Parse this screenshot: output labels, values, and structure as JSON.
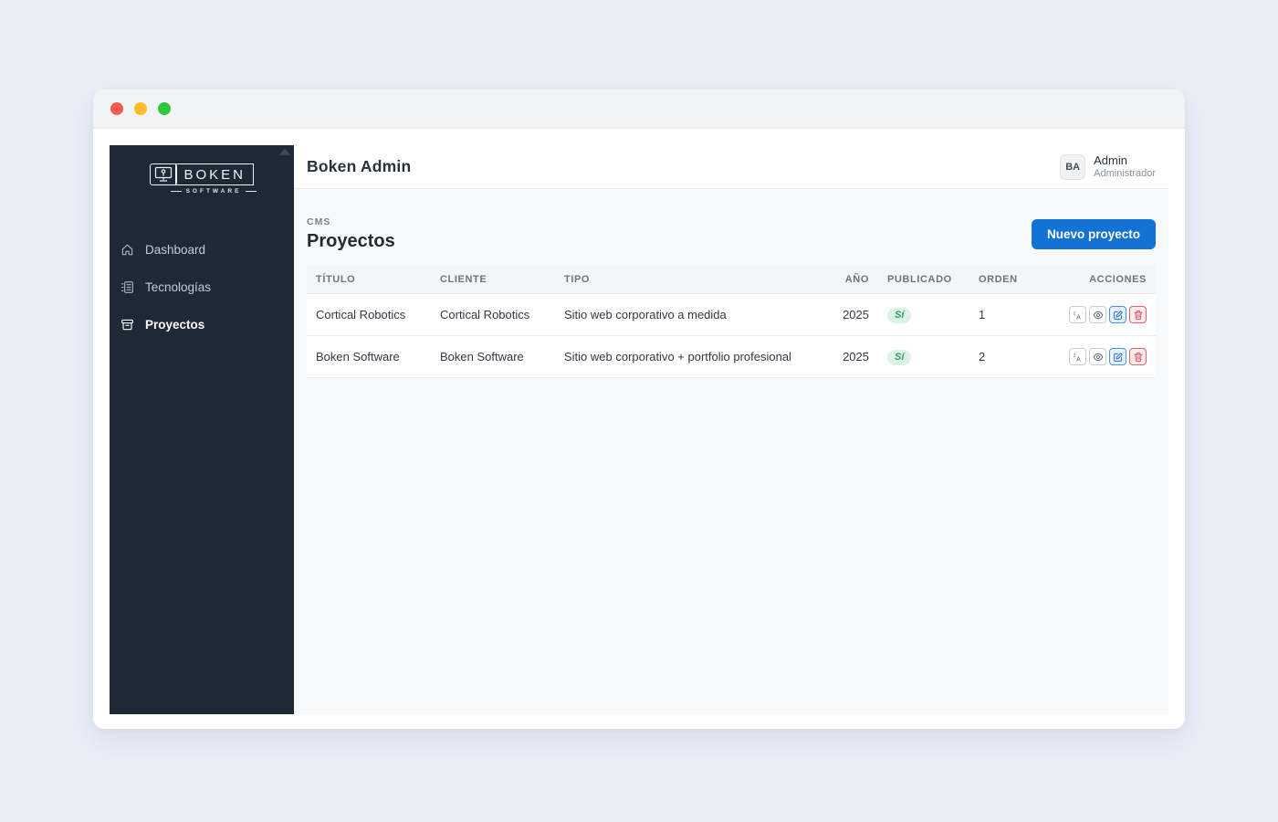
{
  "window": {
    "traffic_lights": {
      "close": "#fb5954",
      "minimize": "#fcba2d",
      "zoom": "#2ec83f"
    }
  },
  "sidebar": {
    "logo": {
      "brand": "BOKEN",
      "sub": "SOFTWARE"
    },
    "items": [
      {
        "label": "Dashboard",
        "icon": "home-icon",
        "active": false
      },
      {
        "label": "Tecnologías",
        "icon": "tech-icon",
        "active": false
      },
      {
        "label": "Proyectos",
        "icon": "projects-icon",
        "active": true
      }
    ]
  },
  "header": {
    "title": "Boken Admin",
    "user": {
      "initials": "BA",
      "name": "Admin",
      "role": "Administrador"
    }
  },
  "page": {
    "breadcrumb": "CMS",
    "title": "Proyectos",
    "new_button": "Nuevo proyecto"
  },
  "table": {
    "columns": [
      "TÍTULO",
      "CLIENTE",
      "TIPO",
      "AÑO",
      "PUBLICADO",
      "ORDEN",
      "ACCIONES"
    ],
    "rows": [
      {
        "titulo": "Cortical Robotics",
        "cliente": "Cortical Robotics",
        "tipo": "Sitio web corporativo a medida",
        "ano": "2025",
        "publicado": "Sí",
        "orden": "1"
      },
      {
        "titulo": "Boken Software",
        "cliente": "Boken Software",
        "tipo": "Sitio web corporativo + portfolio profesional",
        "ano": "2025",
        "publicado": "Sí",
        "orden": "2"
      }
    ],
    "actions": [
      "translate",
      "view",
      "edit",
      "delete"
    ]
  },
  "colors": {
    "primary": "#1273d4",
    "sidebar": "#1e2936",
    "page_background": "#e9eef7",
    "content_background": "#f8f9fb",
    "badge_green_text": "#2f9e60",
    "badge_green_bg": "#dcf2e5",
    "danger": "#d9414f"
  }
}
